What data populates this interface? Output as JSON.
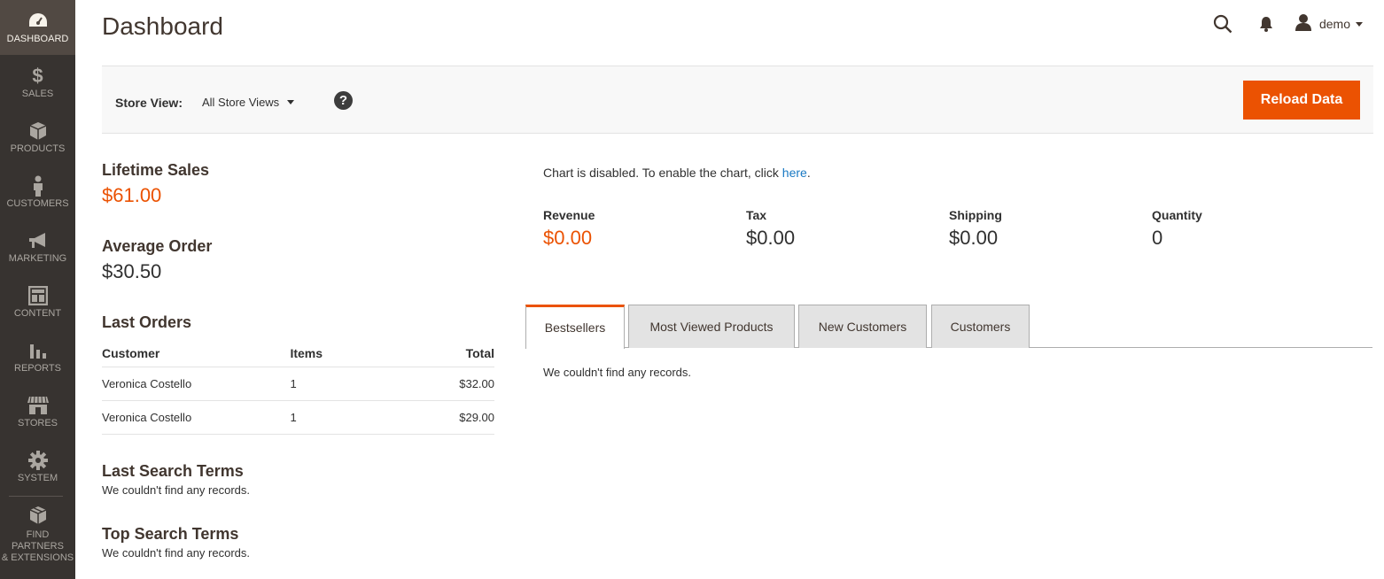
{
  "sidebar": {
    "items": [
      {
        "label": "DASHBOARD",
        "icon": "dashboard-icon"
      },
      {
        "label": "SALES",
        "icon": "dollar-icon"
      },
      {
        "label": "PRODUCTS",
        "icon": "box-icon"
      },
      {
        "label": "CUSTOMERS",
        "icon": "person-icon"
      },
      {
        "label": "MARKETING",
        "icon": "megaphone-icon"
      },
      {
        "label": "CONTENT",
        "icon": "layout-icon"
      },
      {
        "label": "REPORTS",
        "icon": "bar-chart-icon"
      },
      {
        "label": "STORES",
        "icon": "storefront-icon"
      },
      {
        "label": "SYSTEM",
        "icon": "gear-icon"
      }
    ],
    "partners_line1": "FIND PARTNERS",
    "partners_line2": "& EXTENSIONS"
  },
  "header": {
    "title": "Dashboard",
    "user_name": "demo"
  },
  "toolbar": {
    "store_view_label": "Store View:",
    "store_view_value": "All Store Views",
    "help_symbol": "?",
    "reload_label": "Reload Data"
  },
  "stats": {
    "lifetime_sales_title": "Lifetime Sales",
    "lifetime_sales_value": "$61.00",
    "average_order_title": "Average Order",
    "average_order_value": "$30.50"
  },
  "last_orders": {
    "title": "Last Orders",
    "columns": [
      "Customer",
      "Items",
      "Total"
    ],
    "rows": [
      [
        "Veronica Costello",
        "1",
        "$32.00"
      ],
      [
        "Veronica Costello",
        "1",
        "$29.00"
      ]
    ]
  },
  "last_search": {
    "title": "Last Search Terms",
    "empty": "We couldn't find any records."
  },
  "top_search": {
    "title": "Top Search Terms",
    "empty": "We couldn't find any records."
  },
  "chart": {
    "note_prefix": "Chart is disabled. To enable the chart, click ",
    "note_link": "here",
    "note_suffix": "."
  },
  "totals": [
    {
      "label": "Revenue",
      "value": "$0.00"
    },
    {
      "label": "Tax",
      "value": "$0.00"
    },
    {
      "label": "Shipping",
      "value": "$0.00"
    },
    {
      "label": "Quantity",
      "value": "0"
    }
  ],
  "tabs": {
    "items": [
      "Bestsellers",
      "Most Viewed Products",
      "New Customers",
      "Customers"
    ],
    "empty": "We couldn't find any records."
  },
  "colors": {
    "accent": "#eb5202",
    "sidebar": "#373330",
    "sidebar_active": "#514943",
    "link": "#1979c3"
  }
}
